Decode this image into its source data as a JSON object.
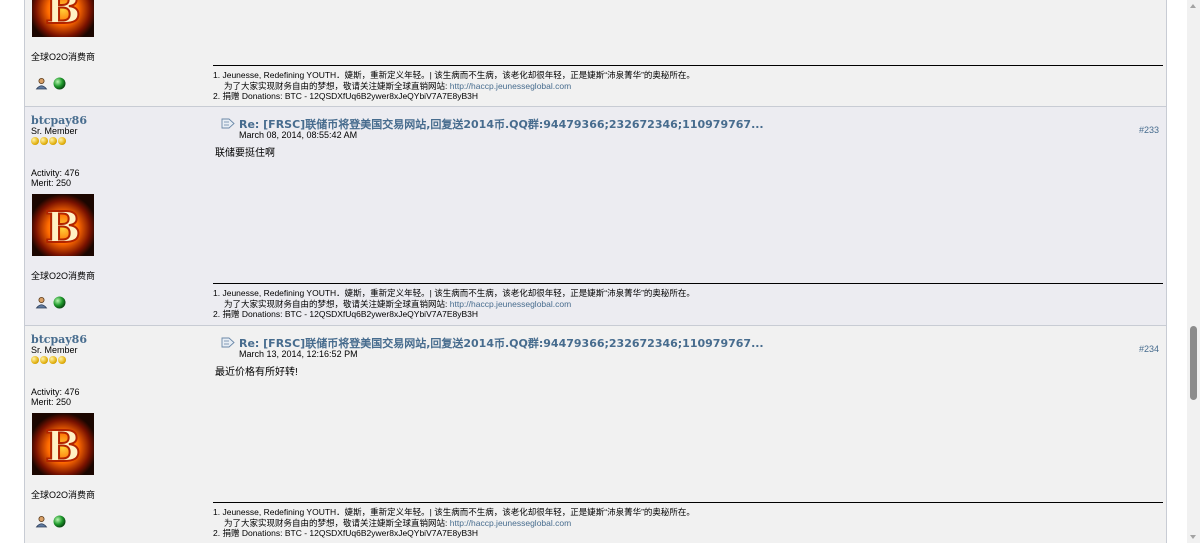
{
  "page": {
    "link_color": "#476c8e"
  },
  "top_post": {
    "personal_text": "全球O2O消费商",
    "signature": {
      "line1_num": "1.",
      "line1": "Jeunesse, Redefining YOUTH．婕斯，重新定义年轻。| 该生病而不生病，该老化却很年轻，正是婕斯“沛泉菁华”的奥秘所在。",
      "line2": "为了大家实现财务自由的梦想，敬请关注婕斯全球直销网站:",
      "line2_link": "http://haccp.jeunesseglobal.com",
      "line3_num": "2.",
      "line3": "捐赠 Donations:  BTC - 12QSDXfUq6B2ywer8xJeQYbiV7A7E8yB3H"
    }
  },
  "posts": [
    {
      "username": "btcpay86",
      "rank": "Sr. Member",
      "activity": "Activity: 476",
      "merit": "Merit: 250",
      "personal_text": "全球O2O消费商",
      "title": "Re: [FRSC]联储币将登美国交易网站,回复送2014币.QQ群:94479366;232672346;110979767...",
      "date": "March 08, 2014, 08:55:42 AM",
      "number": "#233",
      "body": "联储要挺住啊",
      "signature": {
        "line1_num": "1.",
        "line1": "Jeunesse, Redefining YOUTH．婕斯，重新定义年轻。| 该生病而不生病，该老化却很年轻，正是婕斯“沛泉菁华”的奥秘所在。",
        "line2": "为了大家实现财务自由的梦想，敬请关注婕斯全球直销网站:",
        "line2_link": "http://haccp.jeunesseglobal.com",
        "line3_num": "2.",
        "line3": "捐赠 Donations:  BTC - 12QSDXfUq6B2ywer8xJeQYbiV7A7E8yB3H"
      }
    },
    {
      "username": "btcpay86",
      "rank": "Sr. Member",
      "activity": "Activity: 476",
      "merit": "Merit: 250",
      "personal_text": "全球O2O消费商",
      "title": "Re: [FRSC]联储币将登美国交易网站,回复送2014币.QQ群:94479366;232672346;110979767...",
      "date": "March 13, 2014, 12:16:52 PM",
      "number": "#234",
      "body": "最近价格有所好转!",
      "signature": {
        "line1_num": "1.",
        "line1": "Jeunesse, Redefining YOUTH．婕斯，重新定义年轻。| 该生病而不生病，该老化却很年轻，正是婕斯“沛泉菁华”的奥秘所在。",
        "line2": "为了大家实现财务自由的梦想，敬请关注婕斯全球直销网站:",
        "line2_link": "http://haccp.jeunesseglobal.com",
        "line3_num": "2.",
        "line3": "捐赠 Donations:  BTC - 12QSDXfUq6B2ywer8xJeQYbiV7A7E8yB3H"
      }
    }
  ],
  "icons": {
    "profile": "profile-icon",
    "online": "online-status-icon",
    "message": "message-icon",
    "avatar": "avatar-flaming-b"
  },
  "scrollbar": {
    "position_fraction": 0.62
  }
}
